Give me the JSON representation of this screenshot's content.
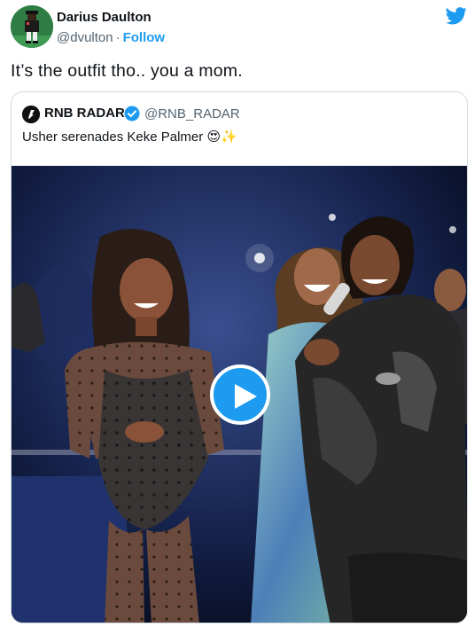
{
  "author": {
    "name": "Darius Daulton",
    "handle": "@dvulton",
    "separator": "·",
    "follow_label": "Follow",
    "avatar": "pixel-art-avatar"
  },
  "brand_icon": "twitter-bird-icon",
  "tweet": {
    "text": "It’s the outfit tho.. you a mom."
  },
  "quoted_tweet": {
    "name": "RNB RADAR",
    "verified": true,
    "handle": "@RNB_RADAR",
    "text": "Usher serenades Keke Palmer",
    "emojis": "😍✨",
    "media": {
      "type": "video",
      "play_icon": "play-icon"
    }
  },
  "colors": {
    "accent": "#1d9bf0",
    "text": "#0f1419",
    "muted": "#536471",
    "border": "#cfd9de"
  }
}
